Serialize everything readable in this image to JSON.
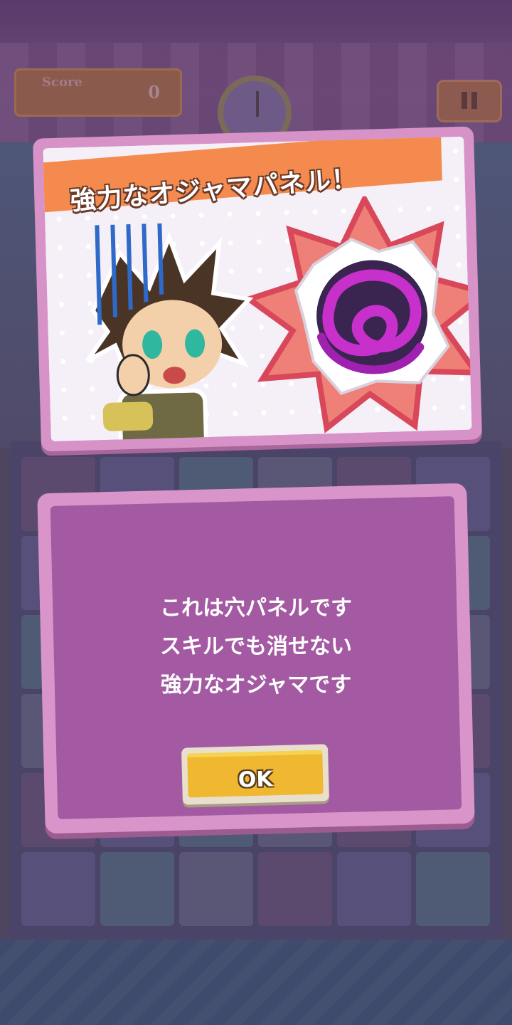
{
  "hud": {
    "score_label": "Score",
    "score_value": "0",
    "pause_icon": "pause-icon",
    "timer_icon": "clock-icon"
  },
  "card": {
    "title": "強力なオジャマパネル！",
    "character_image": "scared-character",
    "panel_image": "hole-panel-vortex"
  },
  "dialog": {
    "lines": [
      "これは穴パネルです",
      "スキルでも消せない",
      "強力なオジャマです"
    ],
    "ok_label": "OK"
  },
  "colors": {
    "dialog_bg": "#a45aa2",
    "dialog_border": "#d995c9",
    "banner": "#f58a4e",
    "ok_button": "#f0b830",
    "burst": "#ee8078",
    "vortex": "#c030c8"
  }
}
